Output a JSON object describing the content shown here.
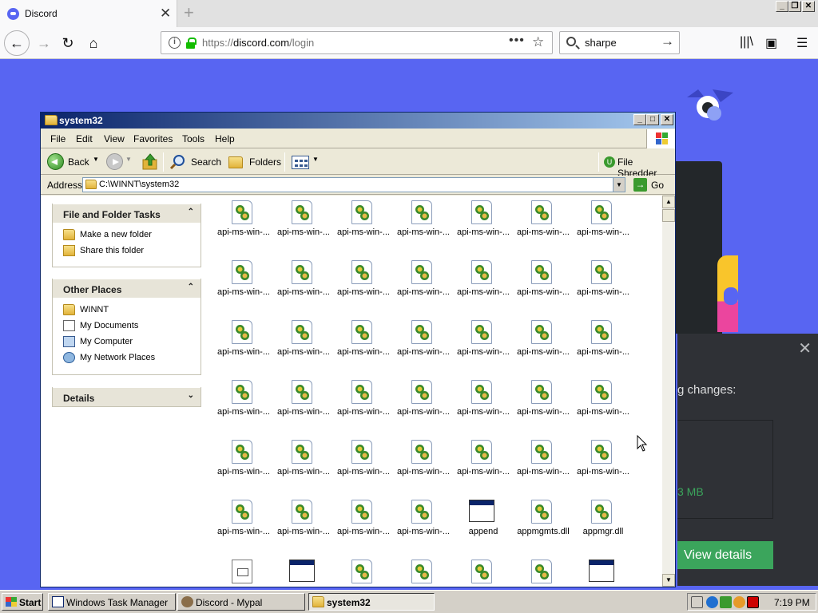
{
  "browser": {
    "tab_title": "Discord",
    "url_prefix": "https://",
    "url_host": "discord.com",
    "url_path": "/login",
    "search_query": "sharpe"
  },
  "discord": {
    "popup_text": "g changes:",
    "popup_size": "3 MB",
    "popup_button": "View details",
    "accent": "#5865f2"
  },
  "explorer": {
    "title": "system32",
    "menu": [
      "File",
      "Edit",
      "View",
      "Favorites",
      "Tools",
      "Help"
    ],
    "toolbar": {
      "back": "Back",
      "search": "Search",
      "folders": "Folders",
      "file_shredder": "File Shredder"
    },
    "address_label": "Address",
    "address_value": "C:\\WINNT\\system32",
    "go_label": "Go",
    "tasks": {
      "file_folder_title": "File and Folder Tasks",
      "make_folder": "Make a new folder",
      "share_folder": "Share this folder",
      "other_places_title": "Other Places",
      "places": [
        "WINNT",
        "My Documents",
        "My Computer",
        "My Network Places"
      ],
      "details_title": "Details"
    },
    "files": [
      "api-ms-win-...",
      "api-ms-win-...",
      "api-ms-win-...",
      "api-ms-win-...",
      "api-ms-win-...",
      "api-ms-win-...",
      "api-ms-win-...",
      "api-ms-win-...",
      "api-ms-win-...",
      "api-ms-win-...",
      "api-ms-win-...",
      "api-ms-win-...",
      "api-ms-win-...",
      "api-ms-win-...",
      "api-ms-win-...",
      "api-ms-win-...",
      "api-ms-win-...",
      "api-ms-win-...",
      "api-ms-win-...",
      "api-ms-win-...",
      "api-ms-win-...",
      "api-ms-win-...",
      "api-ms-win-...",
      "api-ms-win-...",
      "api-ms-win-...",
      "api-ms-win-...",
      "api-ms-win-...",
      "api-ms-win-...",
      "api-ms-win-...",
      "api-ms-win-...",
      "api-ms-win-...",
      "api-ms-win-...",
      "api-ms-win-...",
      "api-ms-win-...",
      "api-ms-win-...",
      "api-ms-win-...",
      "api-ms-win-...",
      "api-ms-win-...",
      "api-ms-win-...",
      "append",
      "appmgmts.dll",
      "appmgr.dll"
    ],
    "file_kinds": [
      "dll",
      "dll",
      "dll",
      "dll",
      "dll",
      "dll",
      "dll",
      "dll",
      "dll",
      "dll",
      "dll",
      "dll",
      "dll",
      "dll",
      "dll",
      "dll",
      "dll",
      "dll",
      "dll",
      "dll",
      "dll",
      "dll",
      "dll",
      "dll",
      "dll",
      "dll",
      "dll",
      "dll",
      "dll",
      "dll",
      "dll",
      "dll",
      "dll",
      "dll",
      "dll",
      "dll",
      "dll",
      "dll",
      "dll",
      "exe",
      "dll",
      "dll",
      "doc",
      "exe",
      "dll",
      "dll",
      "dll",
      "dll",
      "exe"
    ]
  },
  "taskbar": {
    "start": "Start",
    "tasks": [
      "Windows Task Manager",
      "Discord - Mypal",
      "system32"
    ],
    "clock": "7:19 PM"
  }
}
